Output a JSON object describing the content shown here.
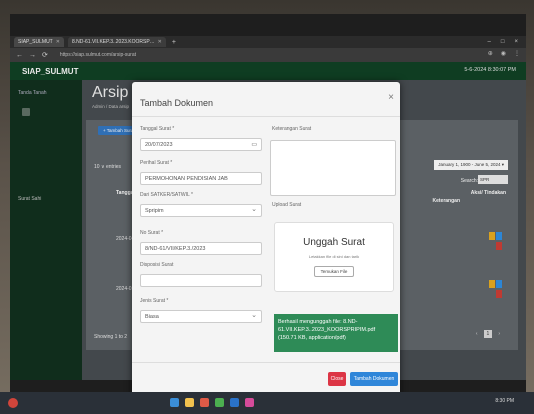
{
  "browser": {
    "tabs": [
      {
        "label": "SIAP_SULMUT",
        "active": true
      },
      {
        "label": "8.ND-61.VII.KEP.3..2023.KOORSP…",
        "active": false
      }
    ],
    "url": "https://siap.sulmut.com/arsip-surat",
    "window_controls": [
      "–",
      "□",
      "×"
    ]
  },
  "app": {
    "brand": "SIAP_SULMUT",
    "datetime": "5-6-2024 8:30:07 PM",
    "sidebar_item_top": "Tanda Tanah",
    "sidebar_item_mid": "Surat Sahi",
    "page_title": "Arsip Surat",
    "page_breadcrumb": "Admin / Data arsip",
    "add_button": "+ Tambah Surat",
    "entries_label": "10 ∨ entries",
    "col_date": "Tanggal Surat",
    "date_filter": "January 1, 1900 - June 5, 2024 ▾",
    "search_label": "Search:",
    "search_value": "SPR",
    "col_keterangan": "Keterangan",
    "col_aksi": "Aksi/ Tindakan",
    "rows": [
      {
        "date": "2024-04-08"
      },
      {
        "date": "2024-02-06"
      }
    ],
    "showing": "Showing 1 to 2",
    "pager": {
      "prev": "‹",
      "current": "1",
      "next": "›"
    }
  },
  "modal": {
    "title": "Tambah Dokumen",
    "close": "×",
    "tanggal_label": "Tanggal Surat *",
    "tanggal_value": "20/07/2023",
    "perihal_label": "Perihal Surat *",
    "perihal_value": "PERMOHONAN PENDISIAN JAB",
    "dari_label": "Dari SATKER/SATWIL *",
    "dari_value": "Spripim",
    "nosurat_label": "No Surat *",
    "nosurat_value": "8/ND-61/VII/KEP.3./2023",
    "disposisi_label": "Disposisi Surat",
    "disposisi_value": "",
    "jenis_label": "Jenis Surat *",
    "jenis_value": "Biasa",
    "keterangan_label": "Keterangan Surat",
    "upload_label": "Upload Surat",
    "dz_title": "Unggah Surat",
    "dz_sub": "Letakkan file di sini dan tarik",
    "dz_button": "Temukan File",
    "success_text": "Berhasil mengunggah file: 8.ND-61.VII.KEP.3..2023_KOORSPRIPIM.pdf (150.71 KB, application/pdf)",
    "btn_close": "Close",
    "btn_submit": "Tambah Dokumen"
  },
  "taskbar": {
    "time": "8:30 PM"
  }
}
